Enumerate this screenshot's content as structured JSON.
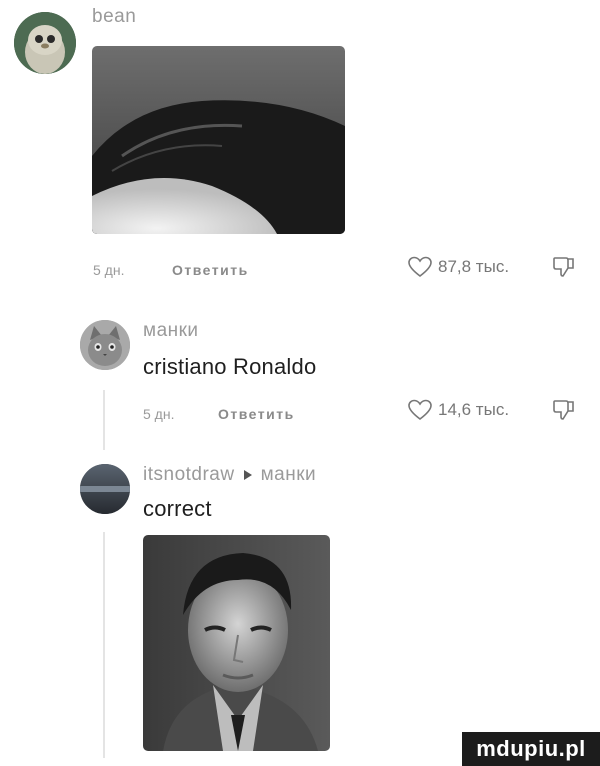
{
  "comments": [
    {
      "username": "bean",
      "text": "",
      "age": "5 дн.",
      "reply_label": "Ответить",
      "likes": "87,8 тыс.",
      "avatar_icon": "kiwi-plush-icon"
    },
    {
      "username": "манки",
      "text": "cristiano Ronaldo",
      "age": "5 дн.",
      "reply_label": "Ответить",
      "likes": "14,6 тыс.",
      "avatar_icon": "cat-avatar-icon"
    },
    {
      "username": "itsnotdraw",
      "reply_to": "манки",
      "text": "correct",
      "avatar_icon": "dark-avatar-icon"
    }
  ],
  "icons": {
    "like": "heart-outline-icon",
    "dislike": "thumbs-down-icon",
    "reply_arrow": "triangle-right-icon"
  },
  "watermark": "mdupiu.pl"
}
